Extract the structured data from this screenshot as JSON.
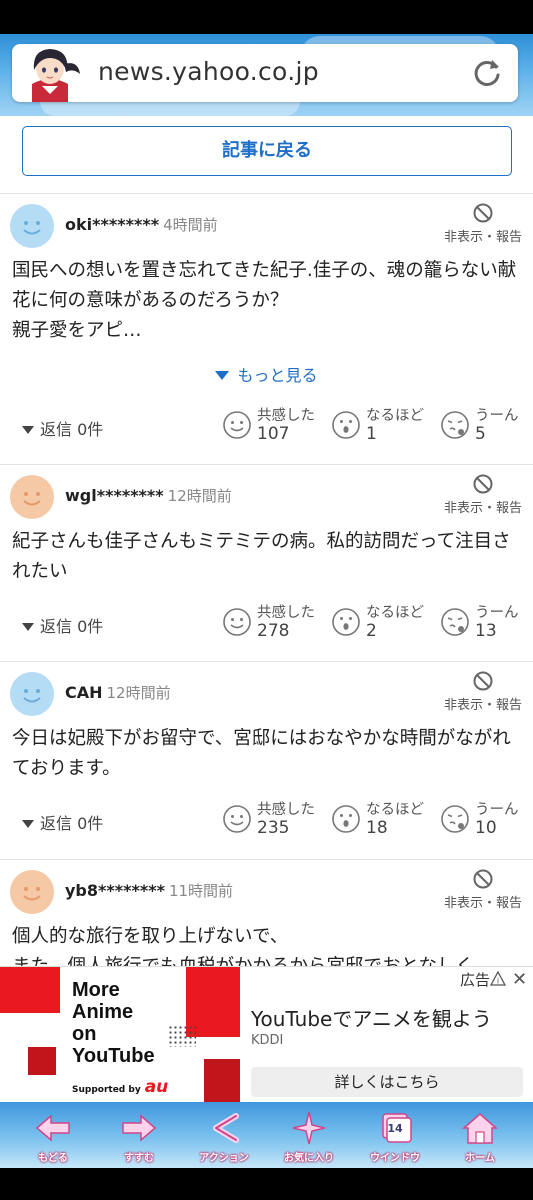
{
  "browser": {
    "url": "news.yahoo.co.jp",
    "avatar_icon": "anime-girl-avatar",
    "reload_icon": "reload-icon"
  },
  "page": {
    "back_button": "記事に戻る"
  },
  "comments": [
    {
      "user": "oki********",
      "time": "4時間前",
      "avatar_color": "#b4dcf5",
      "hide_label": "非表示・報告",
      "body": "国民への想いを置き忘れてきた紀子.佳子の、魂の籠らない献花に何の意味があるのだろうか？\n親子愛をアピ…",
      "more_label": "もっと見る",
      "reply_label": "返信 0件",
      "reactions": [
        {
          "label": "共感した",
          "count": "107"
        },
        {
          "label": "なるほど",
          "count": "1"
        },
        {
          "label": "うーん",
          "count": "5"
        }
      ]
    },
    {
      "user": "wgl********",
      "time": "12時間前",
      "avatar_color": "#f5c9a5",
      "hide_label": "非表示・報告",
      "body": "紀子さんも佳子さんもミテミテの病。私的訪問だって注目されたい",
      "reply_label": "返信 0件",
      "reactions": [
        {
          "label": "共感した",
          "count": "278"
        },
        {
          "label": "なるほど",
          "count": "2"
        },
        {
          "label": "うーん",
          "count": "13"
        }
      ]
    },
    {
      "user": "CAH",
      "time": "12時間前",
      "avatar_color": "#b4dcf5",
      "hide_label": "非表示・報告",
      "body": "今日は妃殿下がお留守で、宮邸にはおなやかな時間がながれております。",
      "reply_label": "返信 0件",
      "reactions": [
        {
          "label": "共感した",
          "count": "235"
        },
        {
          "label": "なるほど",
          "count": "18"
        },
        {
          "label": "うーん",
          "count": "10"
        }
      ]
    },
    {
      "user": "yb8********",
      "time": "11時間前",
      "avatar_color": "#f5c9a5",
      "hide_label": "非表示・報告",
      "body": "個人的な旅行を取り上げないで、\nまた、個人旅行でも血税がかかるから宮邸でおとなしく"
    }
  ],
  "ad": {
    "badge": "広告",
    "close": "✕",
    "image_copy": [
      "More",
      "Anime",
      "on",
      "YouTube"
    ],
    "supported_by": "Supported by",
    "brand": "au",
    "title": "YouTubeでアニメを観よう",
    "sponsor": "KDDI",
    "cta": "詳しくはこちら"
  },
  "bottom_nav": [
    {
      "label": "もどる",
      "icon": "back-arrow-icon"
    },
    {
      "label": "すすむ",
      "icon": "forward-arrow-icon"
    },
    {
      "label": "アクション",
      "icon": "share-icon"
    },
    {
      "label": "お気に入り",
      "icon": "star-sparkle-icon"
    },
    {
      "label": "ウインドウ",
      "icon": "windows-icon",
      "badge": "14"
    },
    {
      "label": "ホーム",
      "icon": "home-icon"
    }
  ],
  "colors": {
    "link_blue": "#1f6fc7",
    "sky_top": "#2f8fd8",
    "ad_red": "#e8191f"
  }
}
